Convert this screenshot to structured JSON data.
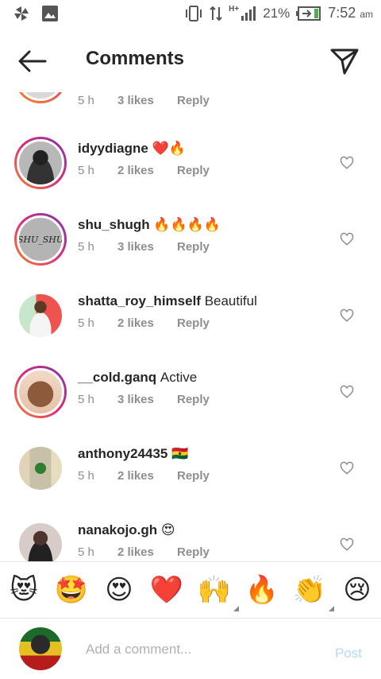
{
  "status_bar": {
    "battery": "21%",
    "network": "H+",
    "time": "7:52",
    "ampm": "am"
  },
  "header": {
    "title": "Comments"
  },
  "comments": [
    {
      "username": "",
      "text": "",
      "time": "5 h",
      "likes": "3 likes",
      "reply": "Reply"
    },
    {
      "username": "idyydiagne",
      "text": "❤️🔥",
      "time": "5 h",
      "likes": "2 likes",
      "reply": "Reply"
    },
    {
      "username": "shu_shugh",
      "text": "🔥🔥🔥🔥",
      "time": "5 h",
      "likes": "3 likes",
      "reply": "Reply",
      "avatar_text": "SHU_SHU"
    },
    {
      "username": "shatta_roy_himself",
      "text": "Beautiful",
      "time": "5 h",
      "likes": "2 likes",
      "reply": "Reply"
    },
    {
      "username": "__cold.ganq",
      "text": "Active",
      "time": "5 h",
      "likes": "3 likes",
      "reply": "Reply"
    },
    {
      "username": "anthony24435",
      "text": "🇬🇭",
      "time": "5 h",
      "likes": "2 likes",
      "reply": "Reply"
    },
    {
      "username": "nanakojo.gh",
      "text": "😍",
      "time": "5 h",
      "likes": "2 likes",
      "reply": "Reply"
    }
  ],
  "emoji_bar": [
    "😻",
    "🤩",
    "😍",
    "❤️",
    "🙌",
    "🔥",
    "👏",
    "😢"
  ],
  "composer": {
    "placeholder": "Add a comment...",
    "post_label": "Post"
  },
  "colors": {
    "accent_post": "#b3dbff",
    "story_ring_start": "#f58529",
    "story_ring_end": "#8134af"
  }
}
